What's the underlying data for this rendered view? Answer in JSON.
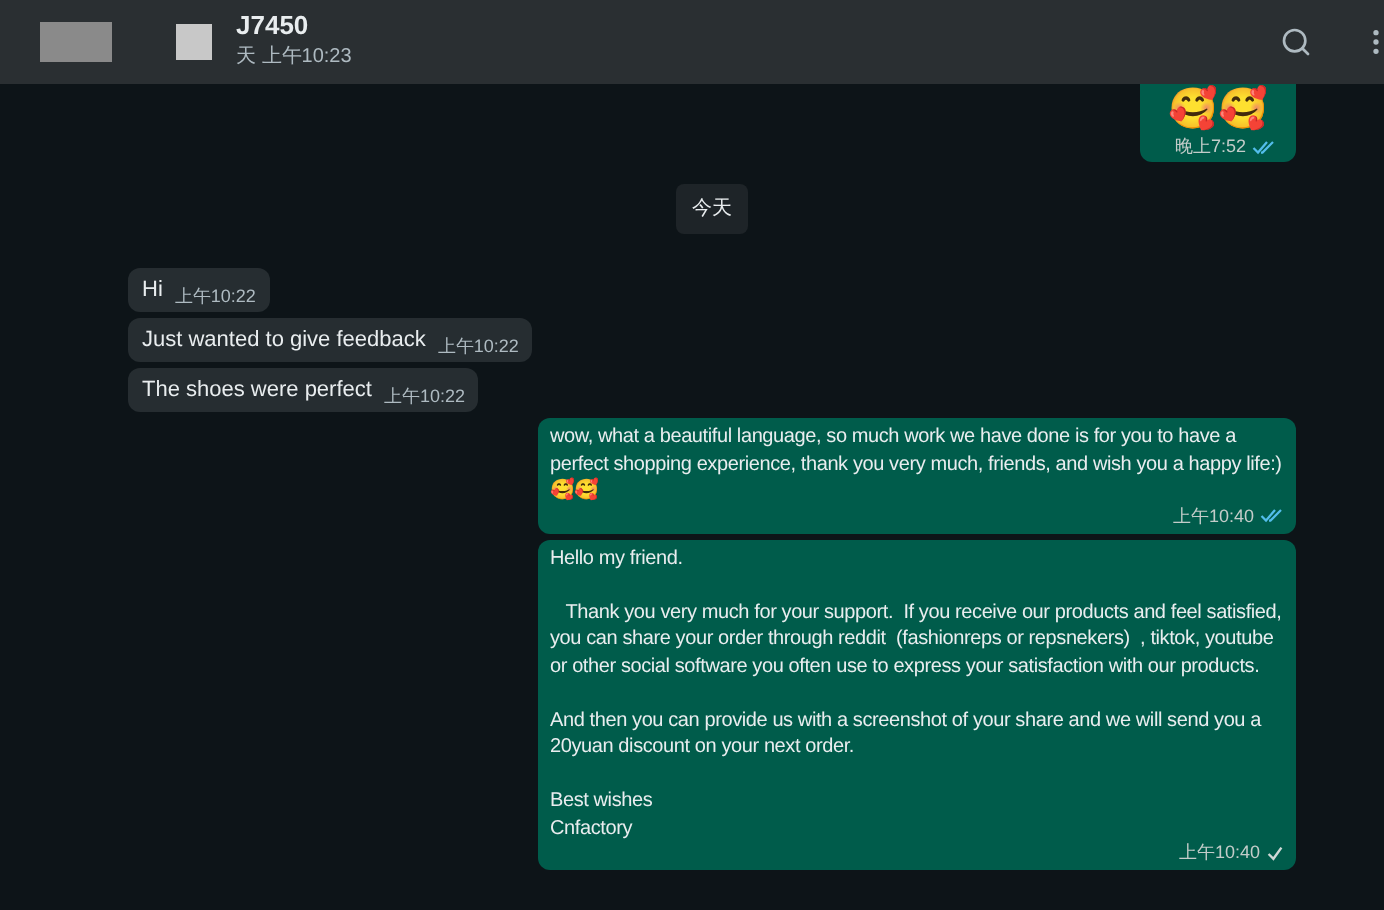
{
  "header": {
    "title": "J7450",
    "subtitle": "天 上午10:23"
  },
  "messages": [
    {
      "kind": "emoji",
      "text": "🥰🥰",
      "time": "晚上7:52",
      "read": true
    },
    {
      "kind": "date",
      "text": "今天"
    },
    {
      "kind": "incoming",
      "text": "Hi",
      "time": "上午10:22"
    },
    {
      "kind": "incoming",
      "text": "Just wanted to give feedback",
      "time": "上午10:22"
    },
    {
      "kind": "incoming",
      "text": "The shoes were perfect",
      "time": "上午10:22"
    },
    {
      "kind": "outgoing",
      "text": "wow, what a beautiful language, so much work we have done is for you to have a perfect shopping experience, thank you very much, friends, and wish you a happy life:)🥰🥰",
      "time": "上午10:40",
      "read": true
    },
    {
      "kind": "outgoing",
      "text": "Hello my friend.\n\n   Thank you very much for your support.  If you receive our products and feel satisfied, you can share your order through reddit  (fashionreps or repsnekers)  , tiktok, youtube or other social software you often use to express your satisfaction with our products.\n\nAnd then you can provide us with a screenshot of your share and we will send you a 20yuan discount on your next order.\n\nBest wishes\nCnfactory",
      "time": "上午10:40",
      "read": false
    }
  ]
}
